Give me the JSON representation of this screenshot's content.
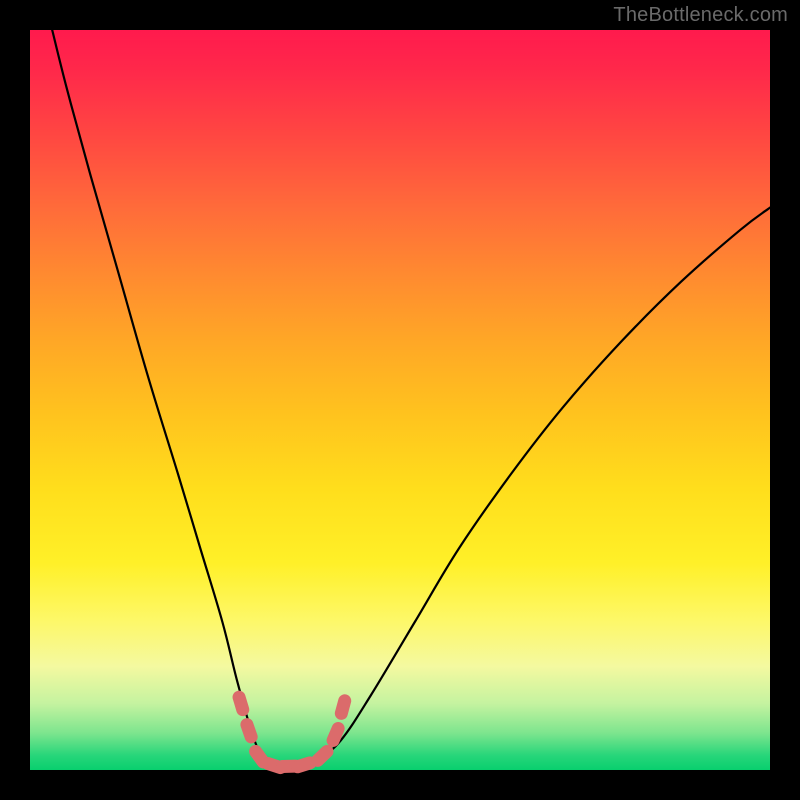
{
  "watermark": "TheBottleneck.com",
  "colors": {
    "frame": "#000000",
    "curve": "#000000",
    "beads": "#db6b6b",
    "gradient_top": "#ff1a4d",
    "gradient_bottom": "#08cf6e"
  },
  "chart_data": {
    "type": "line",
    "title": "",
    "xlabel": "",
    "ylabel": "",
    "xlim": [
      0,
      100
    ],
    "ylim": [
      0,
      100
    ],
    "series": [
      {
        "name": "bottleneck-curve",
        "x": [
          3,
          5,
          8,
          12,
          16,
          20,
          23,
          26,
          28,
          30,
          31.5,
          33,
          35,
          37,
          39,
          42,
          46,
          52,
          58,
          65,
          72,
          80,
          88,
          96,
          100
        ],
        "values": [
          100,
          92,
          81,
          67,
          53,
          40,
          30,
          20,
          12,
          5,
          1.5,
          0.5,
          0.5,
          0.7,
          1.5,
          4,
          10,
          20,
          30,
          40,
          49,
          58,
          66,
          73,
          76
        ]
      }
    ],
    "markers": [
      {
        "x": 28.5,
        "y": 9,
        "label": "bead"
      },
      {
        "x": 29.6,
        "y": 5.3,
        "label": "bead"
      },
      {
        "x": 31.0,
        "y": 1.8,
        "label": "bead"
      },
      {
        "x": 33.0,
        "y": 0.6,
        "label": "bead"
      },
      {
        "x": 35.0,
        "y": 0.5,
        "label": "bead"
      },
      {
        "x": 37.0,
        "y": 0.7,
        "label": "bead"
      },
      {
        "x": 39.5,
        "y": 1.9,
        "label": "bead"
      },
      {
        "x": 41.3,
        "y": 4.8,
        "label": "bead"
      },
      {
        "x": 42.3,
        "y": 8.5,
        "label": "bead"
      }
    ]
  }
}
